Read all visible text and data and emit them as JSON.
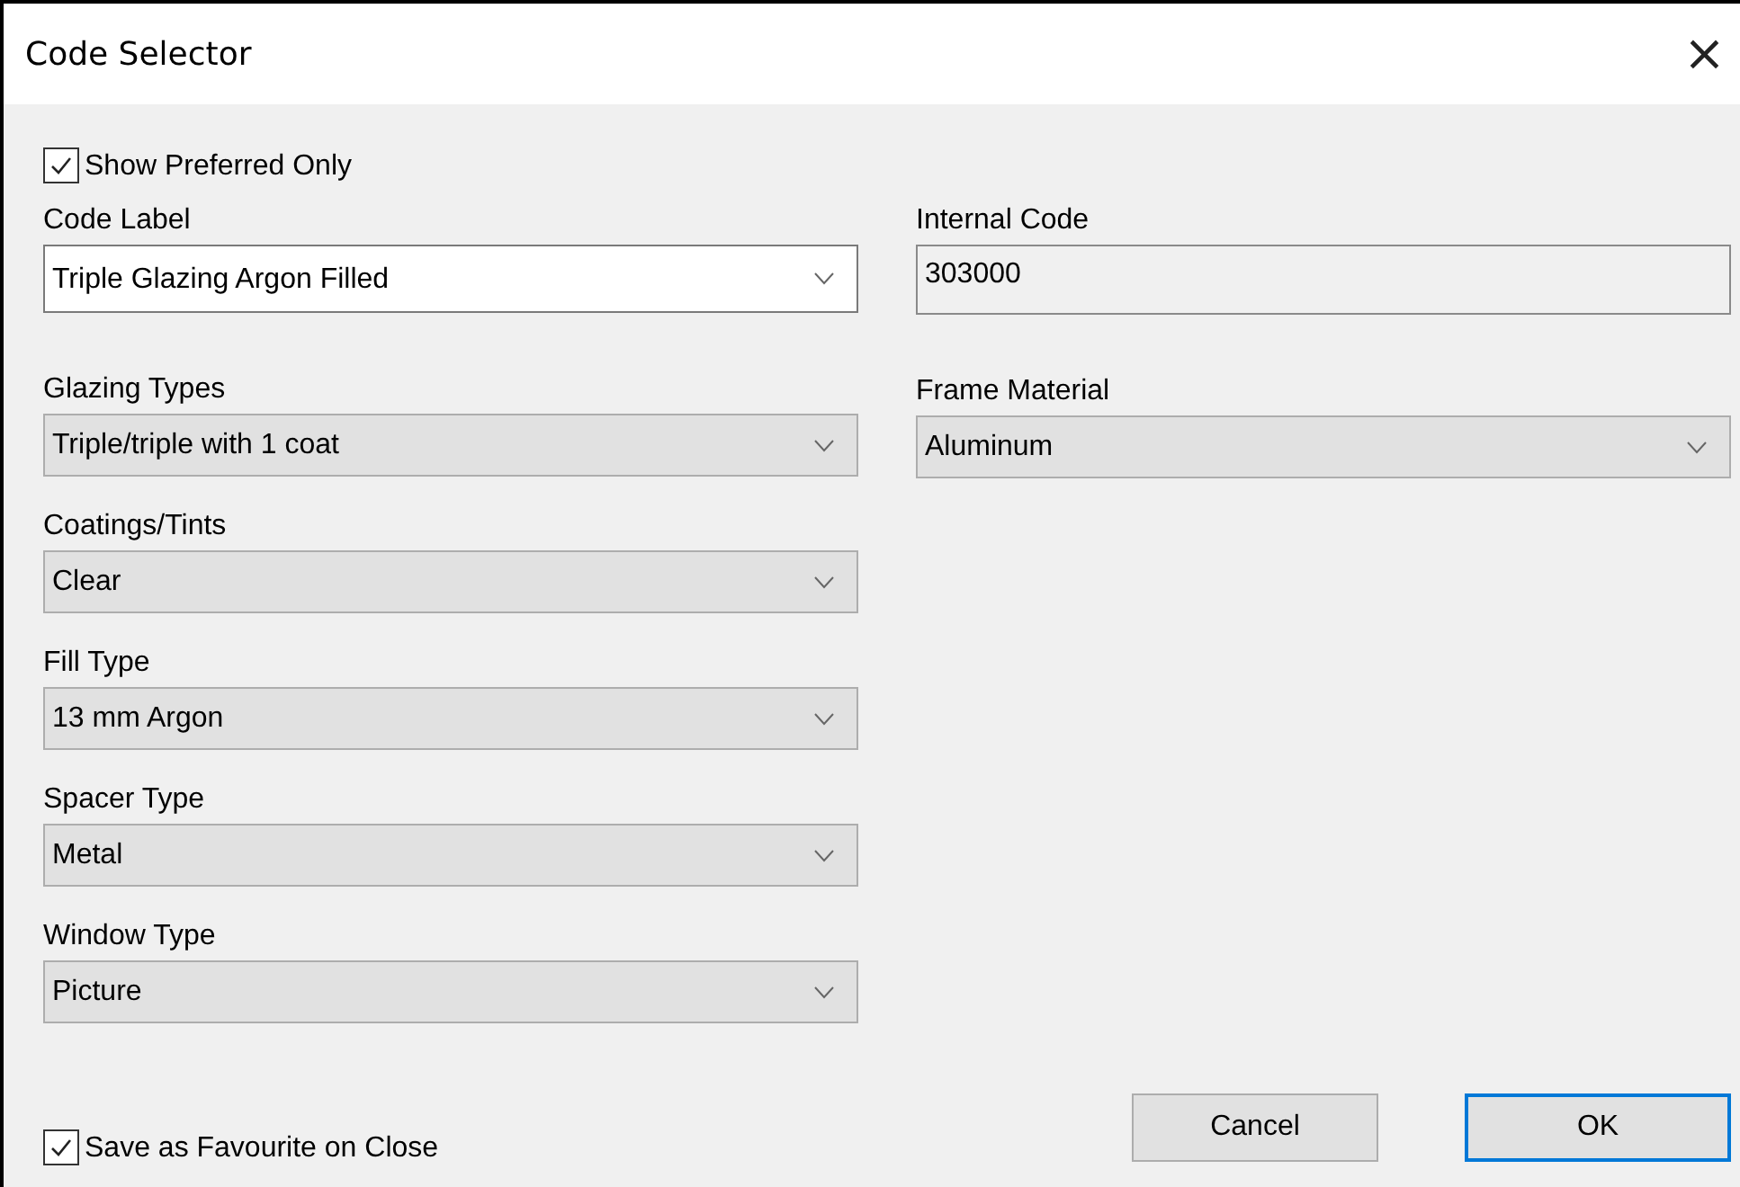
{
  "window": {
    "title": "Code Selector",
    "close": "×"
  },
  "show_preferred": {
    "label": "Show Preferred Only",
    "checked": true
  },
  "left_fields": [
    {
      "label": "Code Label",
      "kind": "editable",
      "value": "Triple Glazing Argon Filled"
    },
    {
      "label": "Glazing Types",
      "kind": "dropdown",
      "value": "Triple/triple with 1 coat"
    },
    {
      "label": "Coatings/Tints",
      "kind": "dropdown",
      "value": "Clear"
    },
    {
      "label": "Fill Type",
      "kind": "dropdown",
      "value": "13 mm Argon"
    },
    {
      "label": "Spacer Type",
      "kind": "dropdown",
      "value": "Metal"
    },
    {
      "label": "Window Type",
      "kind": "dropdown",
      "value": "Picture"
    }
  ],
  "right_fields": [
    {
      "label": "Internal Code",
      "kind": "readonly",
      "value": "303000"
    },
    {
      "label": "Frame Material",
      "kind": "dropdown",
      "value": "Aluminum"
    }
  ],
  "save_favourite": {
    "label": "Save as Favourite on Close",
    "checked": true
  },
  "buttons": [
    {
      "label": "Cancel",
      "default": false
    },
    {
      "label": "OK",
      "default": true
    }
  ]
}
